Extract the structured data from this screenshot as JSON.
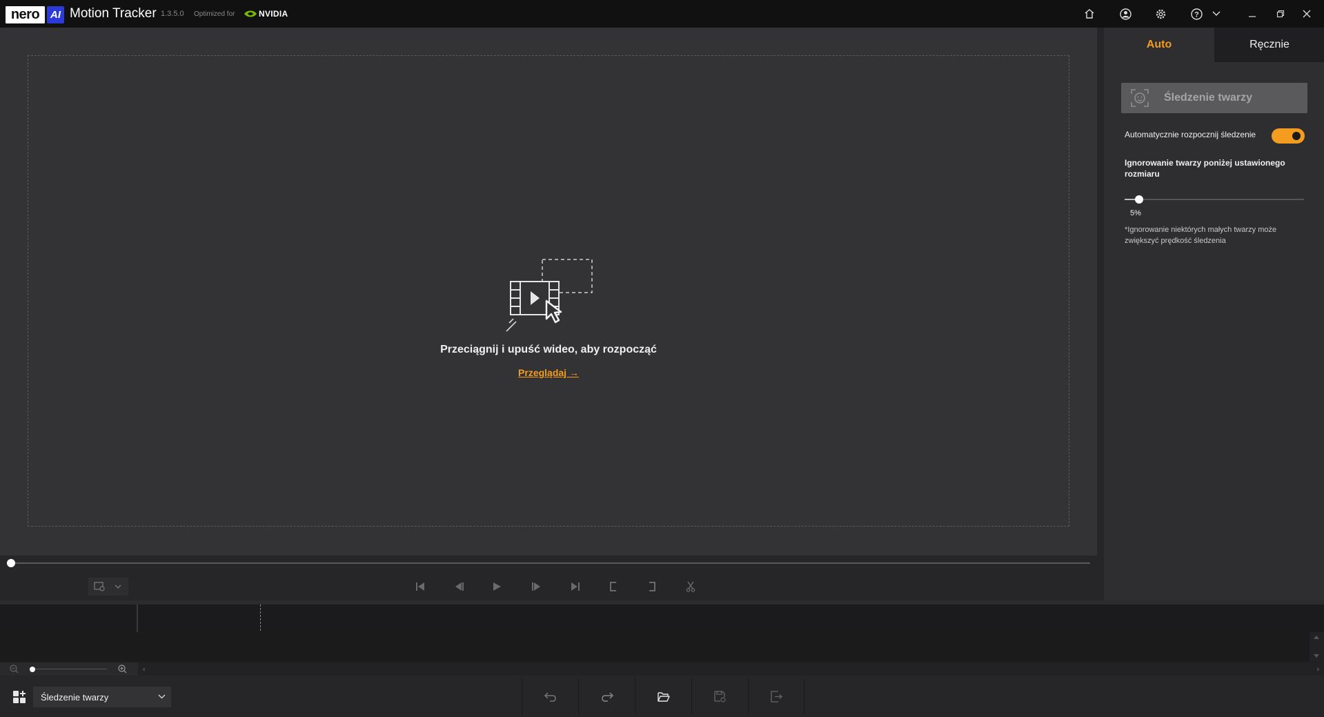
{
  "titlebar": {
    "logo_nero": "nero",
    "logo_ai": "AI",
    "app_name": "Motion Tracker",
    "version": "1.3.5.0",
    "optimized_for": "Optimized for",
    "nvidia": "NVIDIA",
    "icons": [
      "home-icon",
      "account-icon",
      "settings-icon",
      "help-icon",
      "chevron-down-icon",
      "minimize-icon",
      "restore-icon",
      "close-icon"
    ]
  },
  "dropzone": {
    "prompt": "Przeciągnij i upuść wideo, aby rozpocząć",
    "browse": "Przeglądaj →"
  },
  "panel": {
    "tabs": [
      "Auto",
      "Ręcznie"
    ],
    "active_tab": "Auto",
    "face_button": "Śledzenie twarzy",
    "auto_start_label": "Automatycznie rozpocznij śledzenie",
    "auto_start_on": true,
    "ignore_label": "Ignorowanie twarzy poniżej ustawionego rozmiaru",
    "slider_value": "5%",
    "slider_fraction": 0.05,
    "note": "*Ignorowanie niektórych małych twarzy może zwiększyć prędkość śledzenia"
  },
  "playback": {
    "position_fraction": 0.0,
    "controls": [
      "skip-to-start-icon",
      "step-back-icon",
      "play-icon",
      "step-forward-icon",
      "skip-to-end-icon",
      "mark-in-icon",
      "mark-out-icon",
      "cut-icon"
    ]
  },
  "bottom": {
    "mode_select": "Śledzenie twarzy",
    "actions": [
      "undo-icon",
      "redo-icon",
      "open-folder-icon",
      "save-icon",
      "export-icon"
    ]
  },
  "colors": {
    "accent": "#f39c1f",
    "background": "#333335",
    "panel": "#2e2e30"
  }
}
